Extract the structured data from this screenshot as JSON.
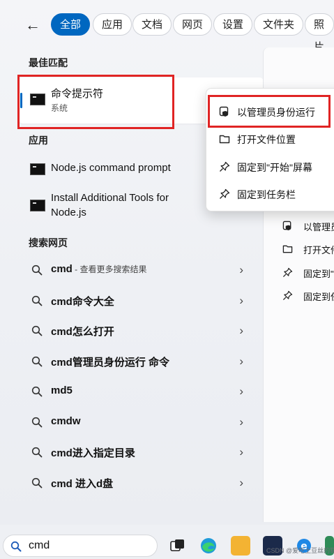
{
  "filters": {
    "back_label": "←",
    "items": [
      {
        "label": "全部",
        "active": true
      },
      {
        "label": "应用",
        "active": false
      },
      {
        "label": "文档",
        "active": false
      },
      {
        "label": "网页",
        "active": false
      },
      {
        "label": "设置",
        "active": false
      },
      {
        "label": "文件夹",
        "active": false
      },
      {
        "label": "照片",
        "active": false
      }
    ]
  },
  "best_match": {
    "section_label": "最佳匹配",
    "title": "命令提示符",
    "subtitle": "系统",
    "icon": "terminal-icon"
  },
  "apps": {
    "section_label": "应用",
    "items": [
      {
        "label": "Node.js command prompt",
        "icon": "terminal-icon"
      },
      {
        "label_line1": "Install Additional Tools for",
        "label_line2": "Node.js",
        "icon": "terminal-icon"
      }
    ]
  },
  "web": {
    "section_label": "搜索网页",
    "items": [
      {
        "label": "cmd",
        "hint": " - 查看更多搜索结果"
      },
      {
        "label": "cmd命令大全",
        "hint": ""
      },
      {
        "label": "cmd怎么打开",
        "hint": ""
      },
      {
        "label": "cmd管理员身份运行 命令",
        "hint": ""
      },
      {
        "label": "md5",
        "hint": ""
      },
      {
        "label": "cmdw",
        "hint": ""
      },
      {
        "label": "cmd进入指定目录",
        "hint": ""
      },
      {
        "label": "cmd 进入d盘",
        "hint": ""
      }
    ],
    "chevron": "›"
  },
  "context_menu": {
    "items": [
      {
        "label": "以管理员身份运行",
        "icon": "shield-icon"
      },
      {
        "label": "打开文件位置",
        "icon": "folder-icon"
      },
      {
        "label": "固定到\"开始\"屏幕",
        "icon": "pin-icon"
      },
      {
        "label": "固定到任务栏",
        "icon": "pin-icon"
      }
    ]
  },
  "right_pane": {
    "items": [
      {
        "label": "以管理员",
        "icon": "shield-icon"
      },
      {
        "label": "打开文件",
        "icon": "folder-icon"
      },
      {
        "label": "固定到\"开",
        "icon": "pin-icon"
      },
      {
        "label": "固定到任",
        "icon": "pin-icon"
      }
    ]
  },
  "taskbar": {
    "search_value": "cmd",
    "watermark": "CSDN @爱吃土豆丝的猫"
  },
  "colors": {
    "accent": "#0067c0",
    "annotation_red": "#e02424"
  }
}
